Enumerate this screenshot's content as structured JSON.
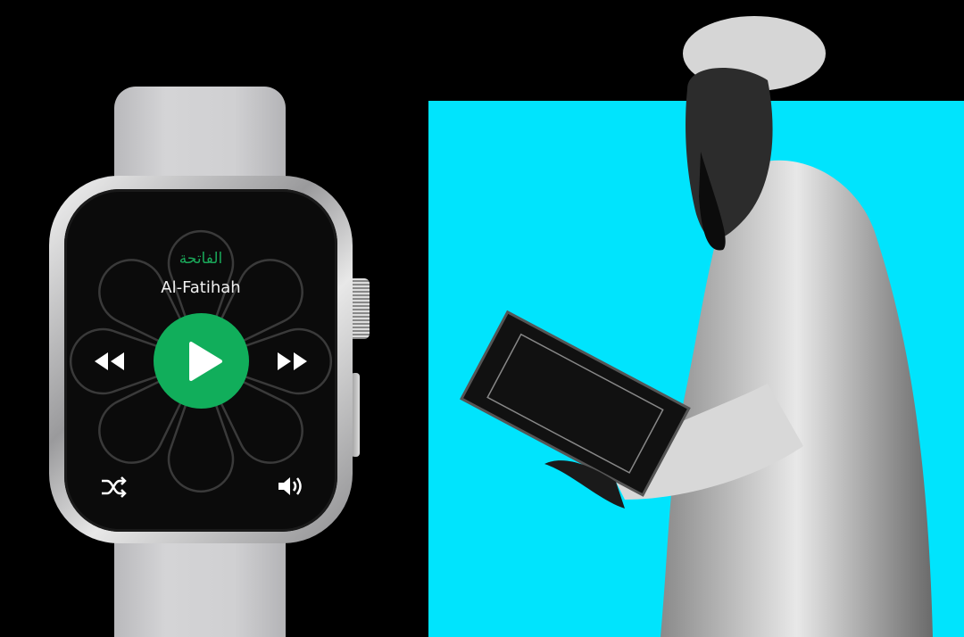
{
  "player": {
    "surah_arabic": "الفاتحة",
    "surah_title": "Al-Fatihah",
    "accent_color": "#11ae5b",
    "controls": [
      "rewind-icon",
      "play-icon",
      "fast-forward-icon",
      "shuffle-icon",
      "volume-icon"
    ]
  },
  "backdrop_color": "#00e4fd"
}
